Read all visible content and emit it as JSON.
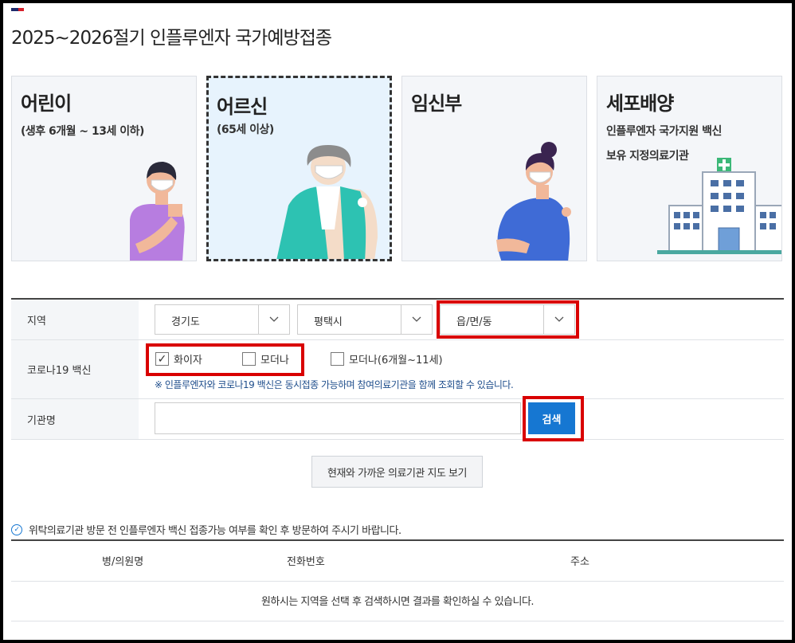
{
  "page": {
    "title": "2025~2026절기 인플루엔자 국가예방접종"
  },
  "cards": [
    {
      "title": "어린이",
      "sub": "(생후 6개월 ~ 13세 이하)",
      "selected": false
    },
    {
      "title": "어르신",
      "sub": "(65세 이상)",
      "selected": true
    },
    {
      "title": "임신부",
      "sub": "",
      "selected": false
    },
    {
      "title": "세포배양",
      "sub_lines": [
        "인플루엔자 국가지원 백신",
        "보유 지정의료기관"
      ],
      "selected": false
    }
  ],
  "form": {
    "region_label": "지역",
    "province": "경기도",
    "city": "평택시",
    "district": "읍/면/동",
    "covid_label": "코로나19 백신",
    "vaccines": [
      {
        "label": "화이자",
        "checked": true
      },
      {
        "label": "모더나",
        "checked": false
      },
      {
        "label": "모더나(6개월~11세)",
        "checked": false
      }
    ],
    "note": "※ 인플루엔자와 코로나19 백신은 동시접종 가능하며 참여의료기관을 함께 조회할 수 있습니다.",
    "org_label": "기관명",
    "org_value": "",
    "search_label": "검색",
    "map_label": "현재와 가까운 의료기관 지도 보기"
  },
  "info": "위탁의료기관 방문 전 인플루엔자 백신 접종가능 여부를 확인 후 방문하여 주시기 바랍니다.",
  "table": {
    "headers": [
      "병/의원명",
      "전화번호",
      "주소"
    ],
    "empty": "원하시는 지역을 선택 후 검색하시면 결과를 확인하실 수 있습니다."
  },
  "colors": {
    "accent": "#1677d2",
    "highlight": "#d90000",
    "selected_card": "#e7f3fd"
  }
}
